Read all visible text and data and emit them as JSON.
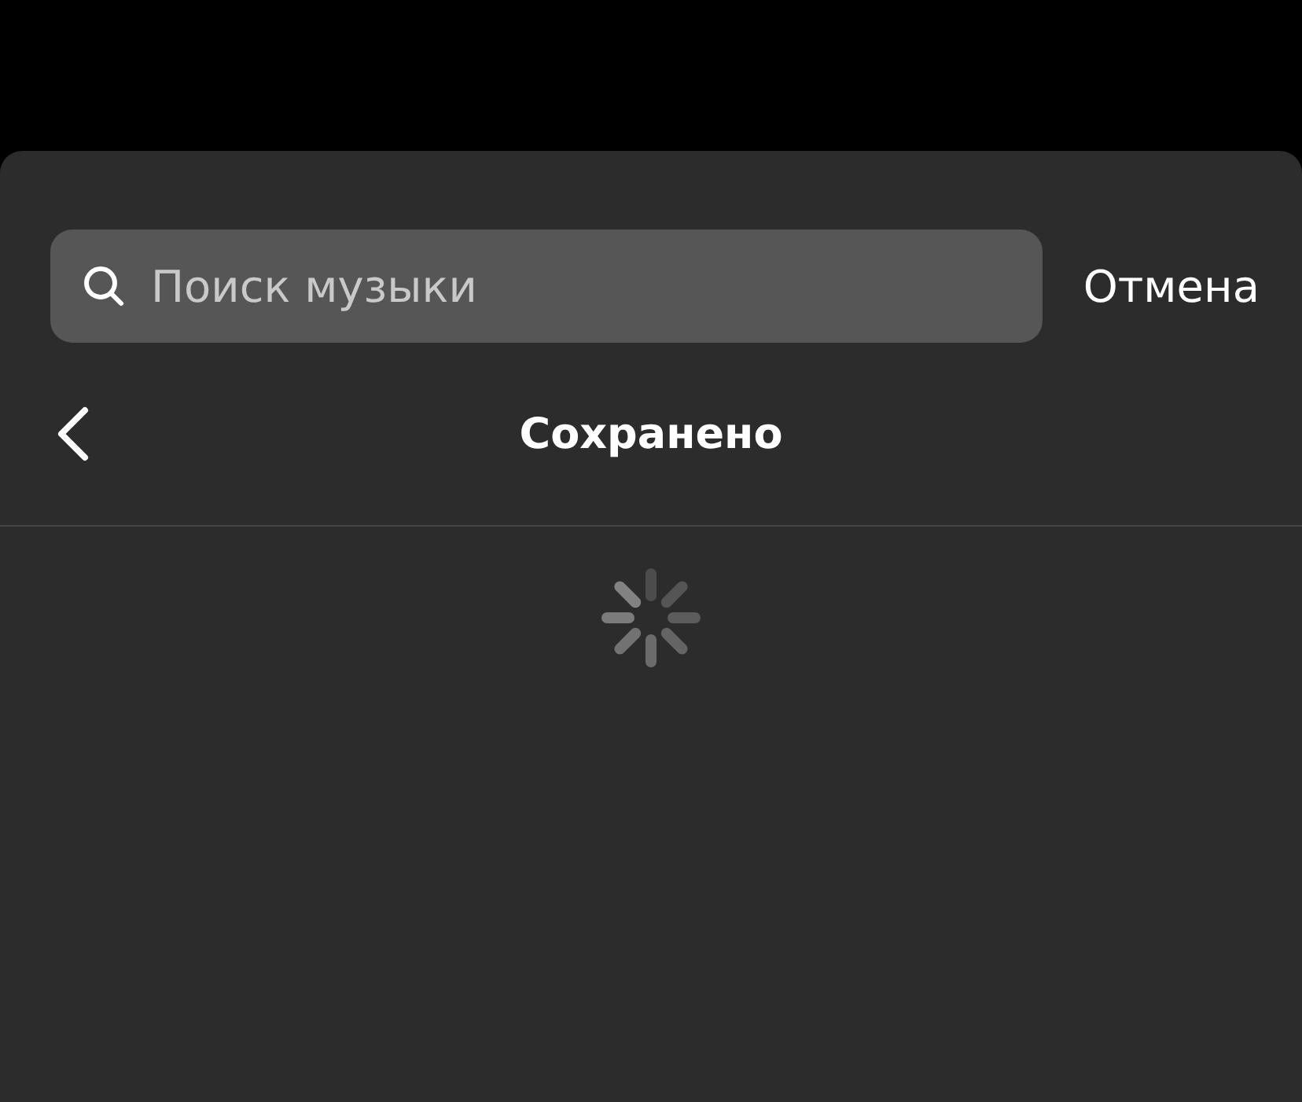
{
  "search": {
    "placeholder": "Поиск музыки"
  },
  "cancel_button": "Отмена",
  "header": {
    "title": "Сохранено"
  }
}
